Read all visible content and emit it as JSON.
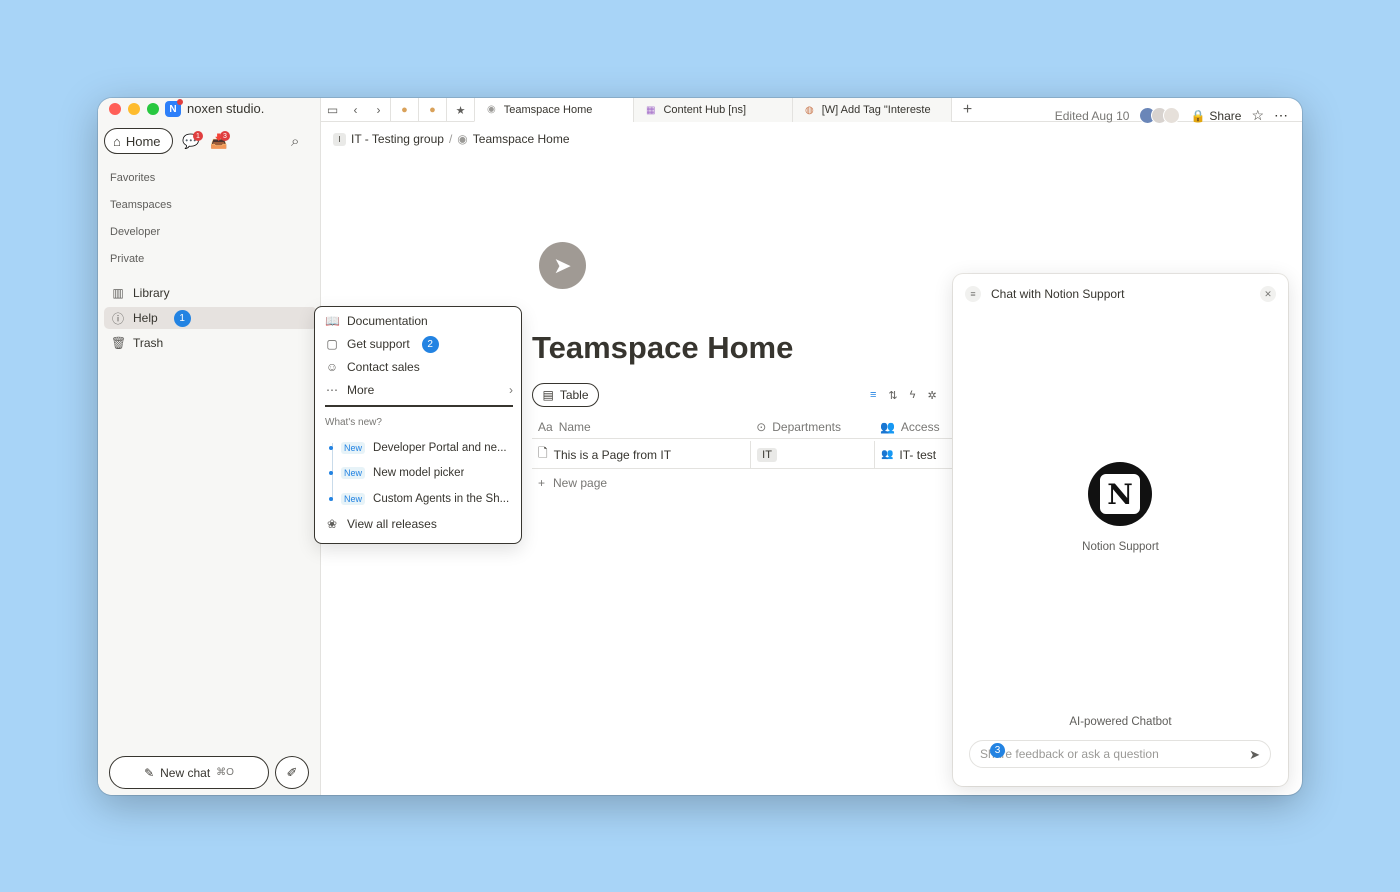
{
  "workspace": {
    "name": "noxen studio."
  },
  "sidebar": {
    "home_label": "Home",
    "chat_badge": "1",
    "inbox_badge": "3",
    "sections": [
      "Favorites",
      "Teamspaces",
      "Developer",
      "Private"
    ],
    "items": [
      {
        "label": "Library",
        "icon": "library-icon"
      },
      {
        "label": "Help",
        "icon": "help-icon",
        "badge": "1"
      },
      {
        "label": "Trash",
        "icon": "trash-icon"
      }
    ],
    "new_chat_label": "New chat",
    "new_chat_shortcut": "⌘O"
  },
  "tabs": [
    {
      "label": "Teamspace Home",
      "icon": "compass-icon"
    },
    {
      "label": "Content Hub [ns]",
      "icon": "database-icon"
    },
    {
      "label": "[W] Add Tag \"Intereste",
      "icon": "page-icon"
    }
  ],
  "breadcrumb": {
    "group_initial": "I",
    "group": "IT - Testing group",
    "sep": "/",
    "page": "Teamspace Home"
  },
  "topbar": {
    "edited": "Edited Aug 10",
    "share_label": "Share"
  },
  "page": {
    "title": "Teamspace Home",
    "view_label": "Table",
    "columns": [
      "Name",
      "Departments",
      "Access"
    ],
    "rows": [
      {
        "name": "This is a Page from IT",
        "department": "IT",
        "access": "IT- test"
      }
    ],
    "new_page_label": "New page"
  },
  "help_menu": {
    "items": [
      {
        "label": "Documentation",
        "icon": "book-icon"
      },
      {
        "label": "Get support",
        "icon": "chat-bubble-icon",
        "badge": "2"
      },
      {
        "label": "Contact sales",
        "icon": "person-circle-icon"
      },
      {
        "label": "More",
        "icon": "more-icon"
      }
    ],
    "whats_new_label": "What's new?",
    "new_tag": "New",
    "releases": [
      "Developer Portal and ne...",
      "New model picker",
      "Custom Agents in the Sh..."
    ],
    "view_all_label": "View all releases"
  },
  "chat": {
    "title": "Chat with Notion Support",
    "bot_name": "Notion Support",
    "footer_label": "AI-powered Chatbot",
    "input_placeholder": "Share feedback or ask a question",
    "marker": "3"
  },
  "colors": {
    "accent": "#2383e2",
    "badge_red": "#e03e3e",
    "desktop": "#a8d4f7"
  }
}
